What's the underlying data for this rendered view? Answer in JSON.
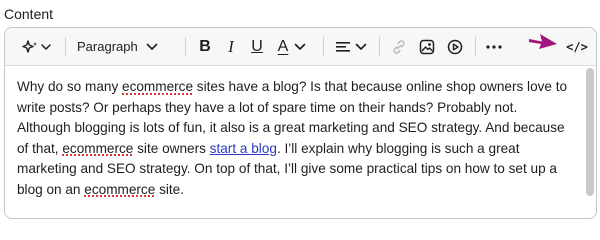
{
  "field": {
    "label": "Content"
  },
  "toolbar": {
    "transform_icon": "sparkle-transform-icon",
    "paragraph_label": "Paragraph",
    "bold_label": "B",
    "italic_label": "I",
    "underline_label": "U",
    "color_label": "A",
    "align_icon": "align-left-icon",
    "link_icon": "link-icon",
    "image_icon": "image-icon",
    "media_icon": "play-circle-icon",
    "more_icon": "more-horizontal-icon",
    "code_view_label": "</>"
  },
  "content": {
    "sentence_1a": "Why do so many ",
    "ecommerce_1": "ecommerce",
    "sentence_1b": " sites have a blog? Is that because online shop owners love to write posts? Or perhaps they have a lot of spare time on their hands? Probably not. Although blogging is lots of fun, it also is a great marketing and SEO strategy. And because of that, ",
    "ecommerce_2": "ecommerce",
    "sentence_2a": " site owners ",
    "link_text": "start a blog",
    "sentence_2b": ". I’ll explain why blogging is such a great marketing and SEO strategy. On top of that, I’ll give some practical tips on how to set up a blog on an ",
    "ecommerce_3": "ecommerce",
    "sentence_2c": " site."
  },
  "colors": {
    "annotation_arrow": "#a3147e",
    "link": "#2b3ac2",
    "spellcheck": "#d63638"
  }
}
